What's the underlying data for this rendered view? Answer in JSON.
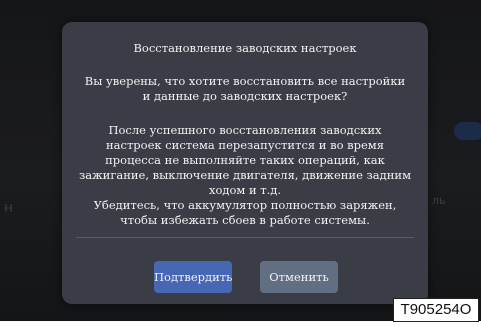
{
  "background": {
    "left_text": "н",
    "right_text": "ль"
  },
  "dialog": {
    "title": "Восстановление заводских настроек",
    "question": "Вы уверены, что хотите восстановить все настройки\nи данные до заводских настроек?",
    "details": "После успешного восстановления заводских\nнастроек система перезапустится и во время\nпроцесса не выполняйте таких операций, как\nзажигание, выключение двигателя, движение задним\nходом и т.д.\nУбедитесь, что аккумулятор полностью заряжен,\nчтобы избежать сбоев в работе системы.",
    "confirm_label": "Подтвердить",
    "cancel_label": "Отменить"
  },
  "figure_code": "T905254O",
  "colors": {
    "dialog_bg": "#3a3d45",
    "confirm_button": "#4767b4",
    "cancel_button": "#626f82",
    "text": "#f2f2f2"
  }
}
